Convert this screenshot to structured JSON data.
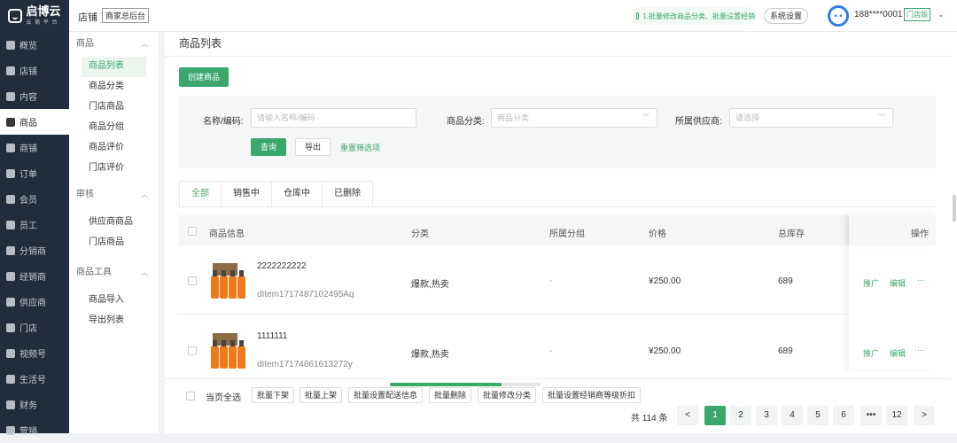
{
  "header": {
    "logo_text": "启博云",
    "logo_sub": "云 商 平 台",
    "store_label": "店铺",
    "store_tag": "商家总后台",
    "notice": "1.批量修改商品分类、批量设置经销",
    "system_settings": "系统设置",
    "phone": "188****0001",
    "user_tag": "门店版"
  },
  "sidebar": {
    "items": [
      {
        "label": "概览",
        "icon": "overview-icon"
      },
      {
        "label": "店铺",
        "icon": "home-icon"
      },
      {
        "label": "内容",
        "icon": "content-icon"
      },
      {
        "label": "商品",
        "icon": "goods-icon",
        "active": true
      },
      {
        "label": "商铺",
        "icon": "heart-icon"
      },
      {
        "label": "订单",
        "icon": "order-icon"
      },
      {
        "label": "会员",
        "icon": "member-icon"
      },
      {
        "label": "员工",
        "icon": "staff-icon"
      },
      {
        "label": "分销商",
        "icon": "distributor-icon"
      },
      {
        "label": "经销商",
        "icon": "dealer-icon"
      },
      {
        "label": "供应商",
        "icon": "supplier-icon"
      },
      {
        "label": "门店",
        "icon": "store-icon"
      },
      {
        "label": "视频号",
        "icon": "video-icon"
      },
      {
        "label": "生活号",
        "icon": "life-icon"
      },
      {
        "label": "财务",
        "icon": "finance-icon"
      },
      {
        "label": "营销",
        "icon": "marketing-icon"
      }
    ]
  },
  "subnav": {
    "group1": "商品",
    "group1_items": [
      "商品列表",
      "商品分类",
      "门店商品",
      "商品分组",
      "商品评价",
      "门店评价"
    ],
    "group2": "审核",
    "group2_items": [
      "供应商商品",
      "门店商品"
    ],
    "group3": "商品工具",
    "group3_items": [
      "商品导入",
      "导出列表"
    ]
  },
  "page": {
    "title": "商品列表",
    "create_button": "创建商品"
  },
  "filter": {
    "name_label": "名称/编码:",
    "name_placeholder": "请输入名称/编码",
    "category_label": "商品分类:",
    "category_placeholder": "商品分类",
    "supplier_label": "所属供应商:",
    "supplier_placeholder": "请选择",
    "query": "查询",
    "export": "导出",
    "reset": "重置筛选项"
  },
  "tabs": [
    "全部",
    "销售中",
    "仓库中",
    "已删除"
  ],
  "table": {
    "headers": {
      "info": "商品信息",
      "category": "分类",
      "group": "所属分组",
      "price": "价格",
      "stock": "总库存",
      "actions": "操作"
    },
    "rows": [
      {
        "name": "2222222222",
        "code": "dItem1717487102495Aq",
        "category": "爆款,热卖",
        "group": "-",
        "price": "¥250.00",
        "stock": "689"
      },
      {
        "name": "1111111",
        "code": "dItem17174861613272y",
        "category": "爆款,热卖",
        "group": "-",
        "price": "¥250.00",
        "stock": "689"
      }
    ],
    "action_promote": "推广",
    "action_edit": "编辑",
    "action_more": "···"
  },
  "bulk": {
    "select_all": "当页全选",
    "buttons": [
      "批量下架",
      "批量上架",
      "批量设置配送信息",
      "批量删除",
      "批量修改分类",
      "批量设置经销商等级折扣"
    ]
  },
  "pagination": {
    "total": "共 114 条",
    "prev": "<",
    "pages": [
      "1",
      "2",
      "3",
      "4",
      "5",
      "6",
      "•••",
      "12"
    ],
    "next": ">"
  },
  "colors": {
    "accent": "#3aa76d",
    "sidebar_bg": "#1f2d3d"
  }
}
